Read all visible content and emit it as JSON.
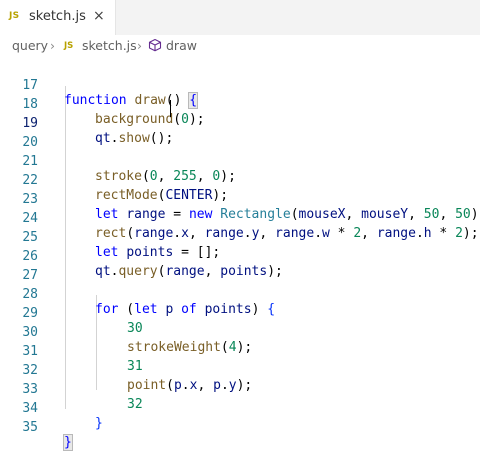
{
  "tab": {
    "js_badge": "JS",
    "filename": "sketch.js",
    "close": "×"
  },
  "breadcrumb": {
    "folder": "query",
    "sep1": "›",
    "js_badge": "JS",
    "file": "sketch.js",
    "sep2": "›",
    "symbol": "draw"
  },
  "colors": {
    "keyword": "#0000ff",
    "function": "#795e26",
    "number": "#098658",
    "line_number": "#237893"
  },
  "editor": {
    "active_line": 19,
    "lines": [
      {
        "n": "17"
      },
      {
        "n": "18"
      },
      {
        "n": "19"
      },
      {
        "n": "20"
      },
      {
        "n": "21"
      },
      {
        "n": "22"
      },
      {
        "n": "23"
      },
      {
        "n": "24"
      },
      {
        "n": "25"
      },
      {
        "n": "26"
      },
      {
        "n": "27"
      },
      {
        "n": "28"
      },
      {
        "n": "29"
      },
      {
        "n": "30"
      },
      {
        "n": "31"
      },
      {
        "n": "32"
      },
      {
        "n": "33"
      },
      {
        "n": "34"
      },
      {
        "n": "35"
      }
    ],
    "code": {
      "l17": [
        "function",
        " ",
        "draw",
        "() ",
        "{"
      ],
      "l18": [
        "background",
        "(",
        "0",
        ");"
      ],
      "l19": [
        "qt",
        ".",
        "show",
        "();"
      ],
      "l21": [
        "stroke",
        "(",
        "0",
        ", ",
        "255",
        ", ",
        "0",
        ");"
      ],
      "l22": [
        "rectMode",
        "(",
        "CENTER",
        ");"
      ],
      "l23": [
        "let",
        " ",
        "range",
        " = ",
        "new",
        " ",
        "Rectangle",
        "(",
        "mouseX",
        ", ",
        "mouseY",
        ", ",
        "50",
        ", ",
        "50",
        ")"
      ],
      "l24": [
        "rect",
        "(",
        "range",
        ".",
        "x",
        ", ",
        "range",
        ".",
        "y",
        ", ",
        "range",
        ".",
        "w",
        " * ",
        "2",
        ", ",
        "range",
        ".",
        "h",
        " * ",
        "2",
        ");"
      ],
      "l25": [
        "let",
        " ",
        "points",
        " = ",
        "[]",
        ";"
      ],
      "l26": [
        "qt",
        ".",
        "query",
        "(",
        "range",
        ", ",
        "points",
        ");"
      ],
      "l28": [
        "for",
        " (",
        "let",
        " ",
        "p",
        " ",
        "of",
        " ",
        "points",
        ") ",
        "{"
      ],
      "l29": [
        "30"
      ],
      "l30": [
        "strokeWeight",
        "(",
        "4",
        ");"
      ],
      "l31": [
        "31"
      ],
      "l32": [
        "point",
        "(",
        "p",
        ".",
        "x",
        ", ",
        "p",
        ".",
        "y",
        ");"
      ],
      "l33": [
        "32"
      ],
      "l34": [
        "}"
      ],
      "l35": [
        "}"
      ]
    }
  }
}
